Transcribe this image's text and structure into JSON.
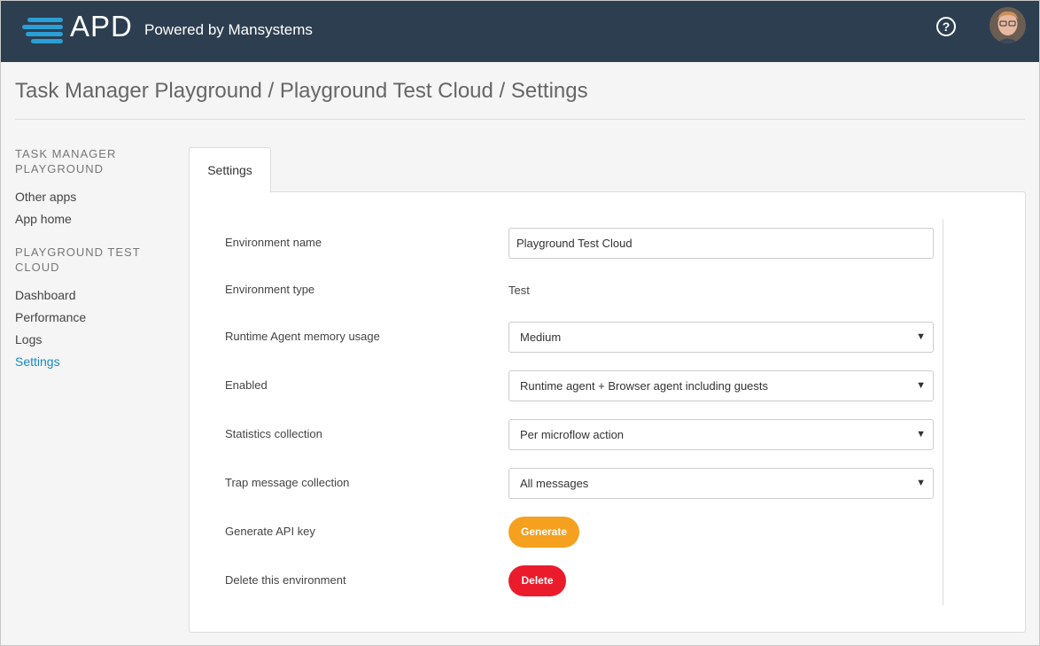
{
  "header": {
    "brand": "APD",
    "tagline": "Powered by Mansystems",
    "help_icon": "question-circle-icon",
    "avatar_icon": "user-avatar"
  },
  "page_title": "Task Manager Playground / Playground Test Cloud / Settings",
  "sidebar": {
    "group1_heading_line1": "TASK MANAGER",
    "group1_heading_line2": "PLAYGROUND",
    "group1_links": [
      "Other apps",
      "App home"
    ],
    "group2_heading_line1": "PLAYGROUND TEST",
    "group2_heading_line2": "CLOUD",
    "group2_links": [
      "Dashboard",
      "Performance",
      "Logs",
      "Settings"
    ],
    "active": "Settings"
  },
  "tab": {
    "label": "Settings"
  },
  "form": {
    "env_name_label": "Environment name",
    "env_name_value": "Playground Test Cloud",
    "env_type_label": "Environment type",
    "env_type_value": "Test",
    "memory_label": "Runtime Agent memory usage",
    "memory_value": "Medium",
    "enabled_label": "Enabled",
    "enabled_value": "Runtime agent + Browser agent including guests",
    "stats_label": "Statistics collection",
    "stats_value": "Per microflow action",
    "trap_label": "Trap message collection",
    "trap_value": "All messages",
    "api_label": "Generate API key",
    "generate_button": "Generate",
    "delete_label": "Delete this environment",
    "delete_button": "Delete"
  },
  "colors": {
    "topbar": "#2d3e50",
    "link_active": "#1a8bc4",
    "generate": "#f5a01f",
    "delete": "#ea1c2c"
  }
}
